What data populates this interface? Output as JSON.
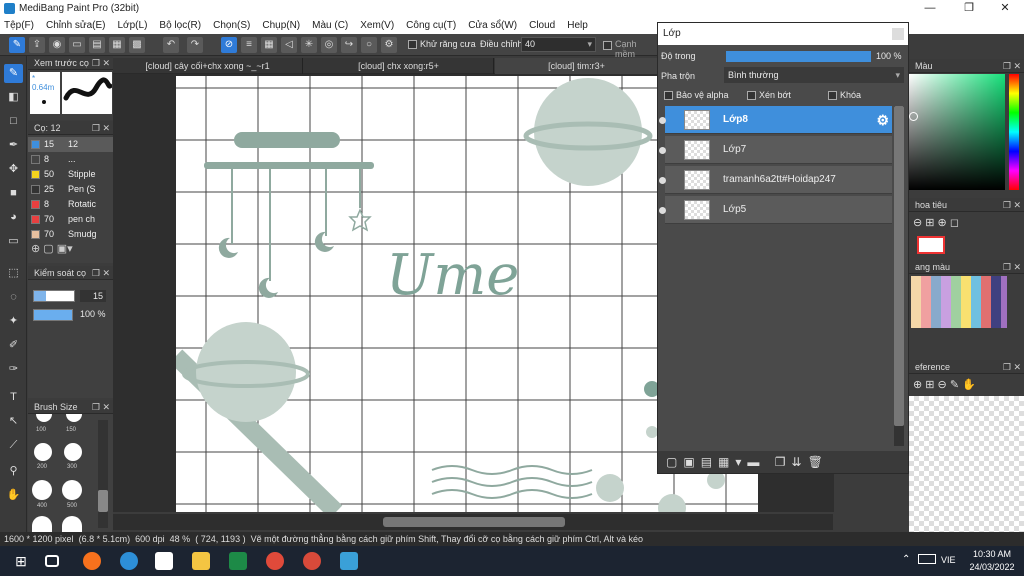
{
  "window": {
    "title": "MediBang Paint Pro (32bit)",
    "minimize": "—",
    "maximize": "❐",
    "close": "✕"
  },
  "menu": [
    "Tệp(F)",
    "Chỉnh sửa(E)",
    "Lớp(L)",
    "Bộ lọc(R)",
    "Chọn(S)",
    "Chụp(N)",
    "Màu (C)",
    "Xem(V)",
    "Công cụ(T)",
    "Cửa sổ(W)",
    "Cloud",
    "Help"
  ],
  "toolbar": {
    "antialias_label": "Khử răng cưa",
    "adjust_label": "Điều chỉnh",
    "adjust_value": "40",
    "edge_label": "Cạnh mềm"
  },
  "panels": {
    "preview_title": "Xem trước cọ",
    "preview_size": "* 0.64m",
    "brush_title": "Cọ: 12",
    "control_title": "Kiểm soát cọ",
    "control_size": "15",
    "control_opacity": "100 %",
    "brushsize_title": "Brush Size",
    "brushsize_labels": [
      "100",
      "150",
      "200",
      "300",
      "400",
      "500"
    ]
  },
  "brushes": [
    {
      "n": "15",
      "name": "12",
      "color": "#3f8fdc"
    },
    {
      "n": "8",
      "name": "...",
      "color": "#444444"
    },
    {
      "n": "50",
      "name": "Stipple",
      "color": "#f5d31d"
    },
    {
      "n": "25",
      "name": "Pen (S",
      "color": "#333333"
    },
    {
      "n": "8",
      "name": "Rotatic",
      "color": "#e74040"
    },
    {
      "n": "70",
      "name": "pen ch",
      "color": "#e74040"
    },
    {
      "n": "70",
      "name": "Smudg",
      "color": "#e6c0a0"
    }
  ],
  "tabs": [
    "[cloud] cây cối+chx xong ~_~r1",
    "[cloud] chx xong:r5+",
    "[cloud] tim:r3+"
  ],
  "canvas_text": "Ume",
  "layers": {
    "title": "Lớp",
    "opacity_label": "Độ trong",
    "opacity_value": "100 %",
    "opacity_fraction": 1.0,
    "blend_label": "Pha trộn",
    "blend_value": "Bình thường",
    "protect_alpha": "Bảo vệ alpha",
    "clip": "Xén bớt",
    "lock": "Khóa",
    "items": [
      "Lớp8",
      "Lớp7",
      "tramanh6a2tt#Hoidap247",
      "Lớp5"
    ]
  },
  "right": {
    "color_title": "Màu",
    "layout_title": "hoa tiêu",
    "palette_title": "ang màu",
    "reference_title": "eference"
  },
  "status": {
    "size": "1600 * 1200 pixel",
    "cm": "(6.8 * 5.1cm)",
    "dpi": "600 dpi",
    "zoom": "48 %",
    "coords": "( 724, 1193 )",
    "hint": "Vẽ một đường thẳng bằng cách giữ phím Shift, Thay đổi cỡ cọ bằng cách giữ phím Ctrl, Alt và kéo"
  },
  "taskbar": {
    "lang": "VIE",
    "time": "10:30 AM",
    "date": "24/03/2022"
  },
  "colors": {
    "accent": "#3f8fdc",
    "ink": "#7fa397",
    "grid": "#444444"
  }
}
